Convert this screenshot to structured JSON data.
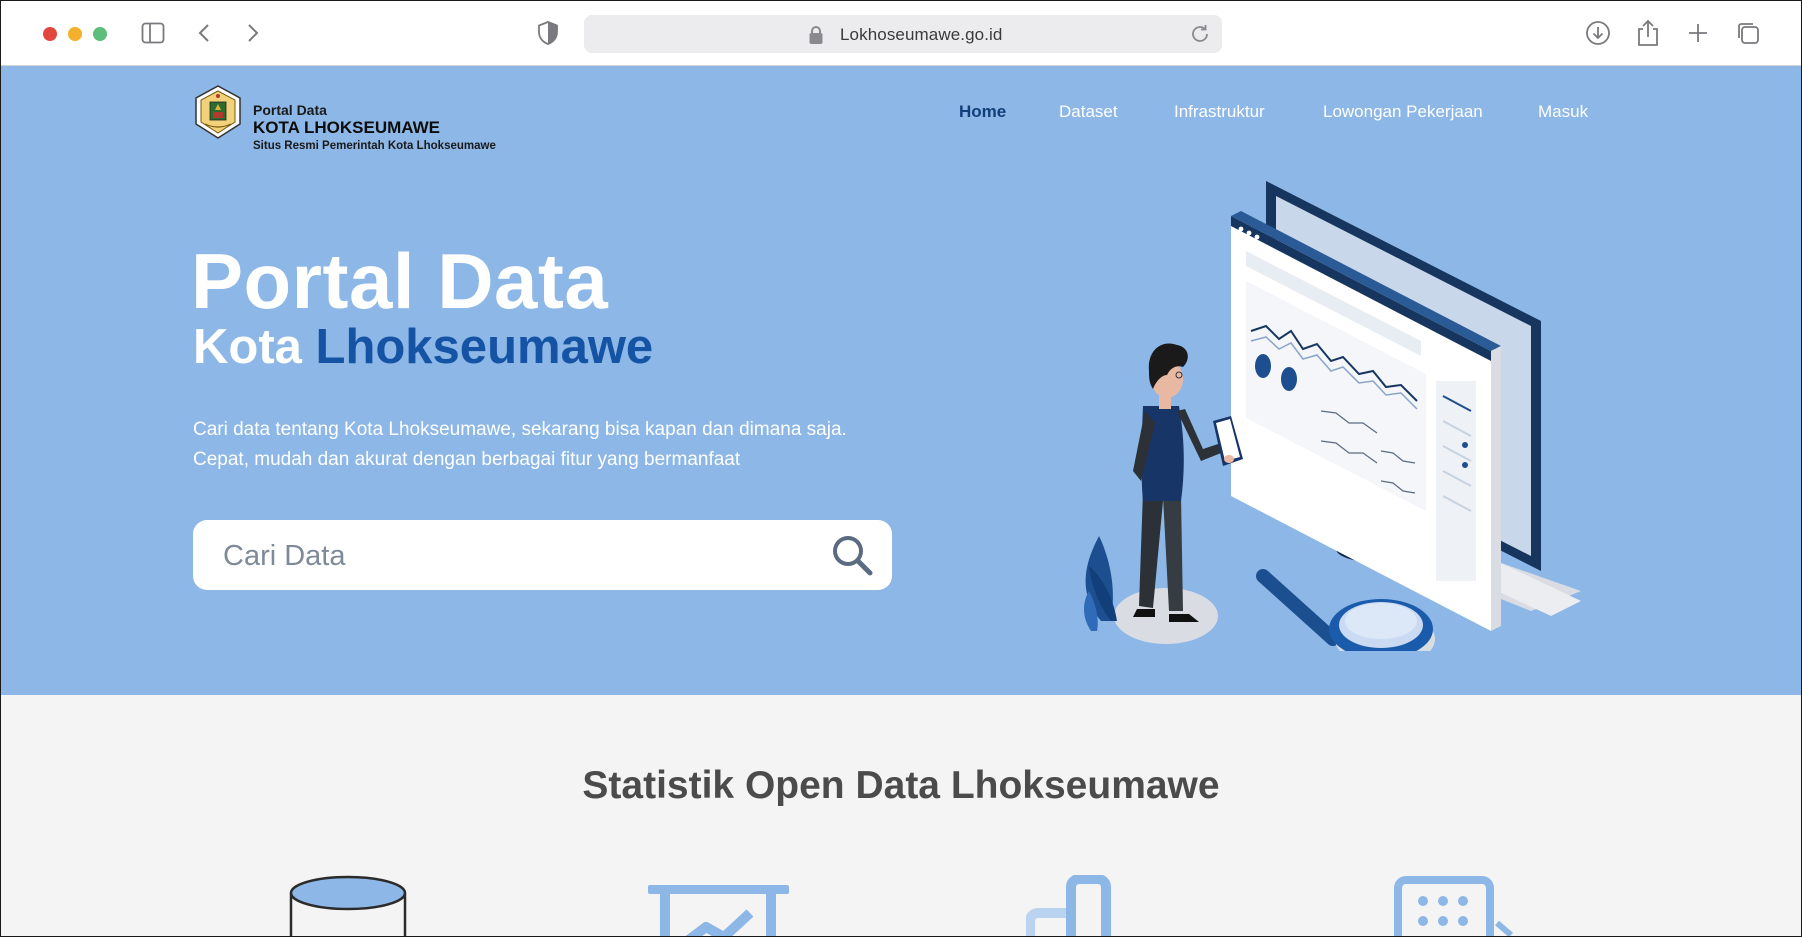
{
  "browser": {
    "url": "Lokhoseumawe.go.id"
  },
  "brand": {
    "line1": "Portal Data",
    "line2": "KOTA LHOKSEUMAWE",
    "line3": "Situs Resmi Pemerintah Kota Lhokseumawe"
  },
  "nav": {
    "items": [
      {
        "label": "Home",
        "active": true
      },
      {
        "label": "Dataset"
      },
      {
        "label": "Infrastruktur"
      },
      {
        "label": "Lowongan Pekerjaan"
      },
      {
        "label": "Masuk"
      }
    ]
  },
  "hero": {
    "title": "Portal Data",
    "subtitle_white": "Kota",
    "subtitle_blue": "Lhokseumawe",
    "desc_line1": "Cari data tentang Kota Lhokseumawe, sekarang bisa kapan dan dimana saja.",
    "desc_line2": "Cepat, mudah dan akurat dengan berbagai fitur yang bermanfaat"
  },
  "search": {
    "placeholder": "Cari Data"
  },
  "stats": {
    "title": "Statistik Open Data Lhokseumawe",
    "icons": [
      "database-icon",
      "presentation-chart-icon",
      "bar-chart-icon",
      "calendar-grid-icon"
    ]
  },
  "colors": {
    "hero_bg": "#8cb7e6",
    "accent_blue": "#1553a5",
    "nav_active": "#123e7a",
    "section_bg": "#f4f4f4"
  }
}
